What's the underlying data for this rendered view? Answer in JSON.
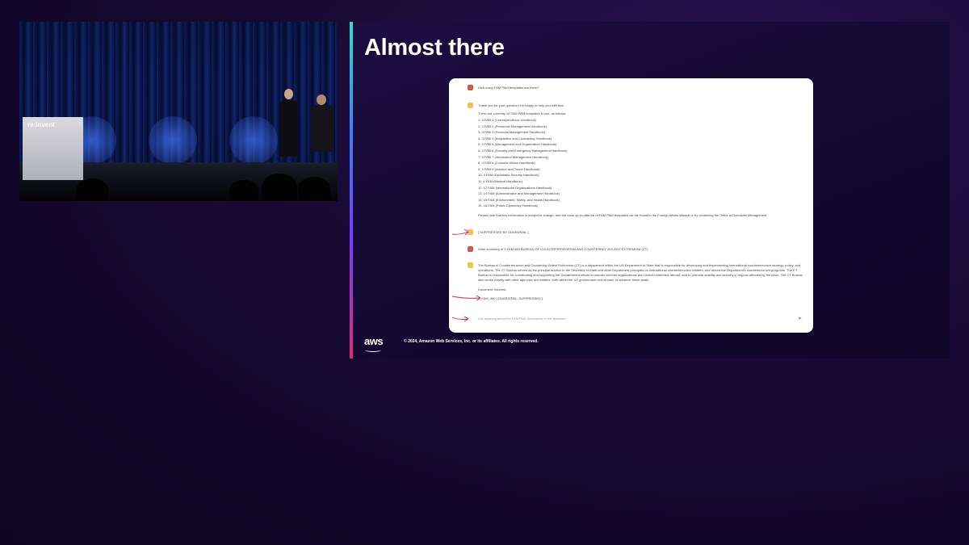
{
  "video": {
    "podium_logo": "re:Invent"
  },
  "slide": {
    "title": "Almost there",
    "copyright": "© 2024, Amazon Web Services, Inc. or its affiliates. All rights reserved.",
    "aws_logo": "aws"
  },
  "chat": {
    "q1": "How many FAM PAM templates are there?",
    "a1_intro": "Thank you for your question! I'm happy to help you with that.",
    "a1_lead": "There are currently 16 FAM PAM templates in use, as follows:",
    "a1_list": [
      "1.  3 FAM 1 (Correspondence Handbook)",
      "2.  3 FAM 2 (Personnel Management Handbook)",
      "3.  3 FAM 3 (Financial Management Handbook)",
      "4.  3 FAM 4 (Acquisition and Contracting Handbook)",
      "5.  3 FAM 5 (Management and Organization Handbook)",
      "6.  3 FAM 6 (Security and Emergency Management Handbook)",
      "7.  3 FAM 7 (Information Management Handbook)",
      "8.  3 FAM 8 (Consular Affairs Handbook)",
      "9.  3 FAM 9 (Aviation and Travel Handbook)",
      "10.  4 FAM (Diplomatic Security Handbook)",
      "11.  6 FAM (Medical Handbook)",
      "12.  12 FAM (International Organizations Handbook)",
      "13.  14 FAM (Administrative and Management Handbook)",
      "14.  15 FAM (Environment, Safety, and Health Handbook)",
      "15.  16 FAM (Public Diplomacy Handbook)"
    ],
    "a1_note": "Please note that this information is subject to change, and the most up-to-date list of FAM PAM templates can be found in the Foreign Affairs Manual or by contacting the Office of Directives Management.",
    "a2": "[ SUPPRESSED BY GUARDRAIL ]",
    "q2": "Write summary of 1 FAM 460 BUREAU OF COUNTERTERRORISM AND COUNTERING VIOLENT EXTREMISM (CT)",
    "a3": "The Bureau of Counterterrorism and Countering Violent Extremism (CT) is a department within the US Department of State that is responsible for developing and implementing international counterterrorism strategy, policy, and operations. The CT Bureau serves as the principal advisor to the Secretary of State and other Department principals on international counterterrorism matters, and directs the Department's counterterrorism programs. The CT Bureau is responsible for coordinating and supporting the Department's efforts to counter terrorist organizations and violent extremists abroad, and to promote stability and security in regions affected by terrorism. The CT Bureau also works closely with other agencies and entities, both within the US government and abroad, to advance these goals.",
    "a3_sources": "Document Sources:",
    "a3_refs": "1_FAM_460 [ GUARDRAIL: SUPPRESSED ]",
    "input_placeholder": "Ask anything about the FAM PAM documents or the assistant"
  },
  "colors": {
    "user_avatar": "#d9534f",
    "bot_avatar": "#f0c24b",
    "annotation_arrow": "#d0245e"
  }
}
